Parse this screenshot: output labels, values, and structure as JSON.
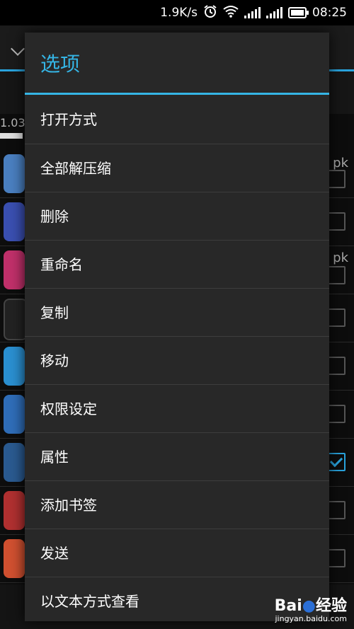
{
  "status_bar": {
    "speed": "1.9K/s",
    "time": "08:25",
    "icons": [
      "alarm-icon",
      "wifi-icon",
      "signal-icon",
      "signal-icon",
      "battery-icon"
    ]
  },
  "background": {
    "storage_text": "1.03",
    "ext_a": "pk",
    "ext_b": "pk"
  },
  "dialog": {
    "title": "选项",
    "items": [
      "打开方式",
      "全部解压缩",
      "删除",
      "重命名",
      "复制",
      "移动",
      "权限设定",
      "属性",
      "添加书签",
      "发送",
      "以文本方式查看"
    ]
  },
  "watermark": {
    "logo": "Bai",
    "logo_suffix": "经验",
    "url": "jingyan.baidu.com"
  },
  "colors": {
    "accent": "#35b5e5",
    "dialog_bg": "#282828",
    "divider": "#3d3d3d"
  }
}
